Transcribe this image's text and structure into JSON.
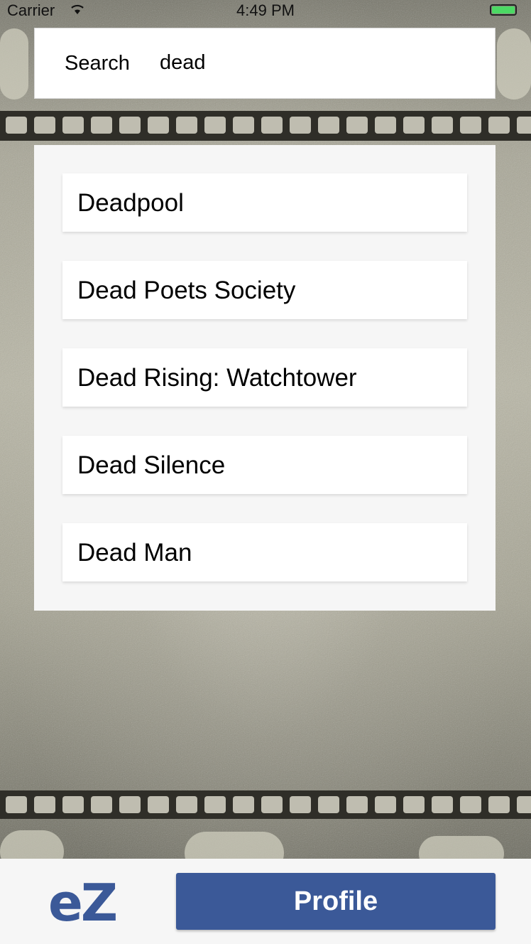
{
  "status_bar": {
    "carrier": "Carrier",
    "time": "4:49 PM",
    "battery_color": "#4cd964"
  },
  "search": {
    "label": "Search",
    "value": "dead"
  },
  "results": [
    {
      "title": "Deadpool"
    },
    {
      "title": "Dead Poets Society"
    },
    {
      "title": "Dead Rising: Watchtower"
    },
    {
      "title": "Dead Silence"
    },
    {
      "title": "Dead Man"
    }
  ],
  "bottom_bar": {
    "logo_text": "eZ",
    "profile_label": "Profile",
    "accent_color": "#3b5998"
  }
}
